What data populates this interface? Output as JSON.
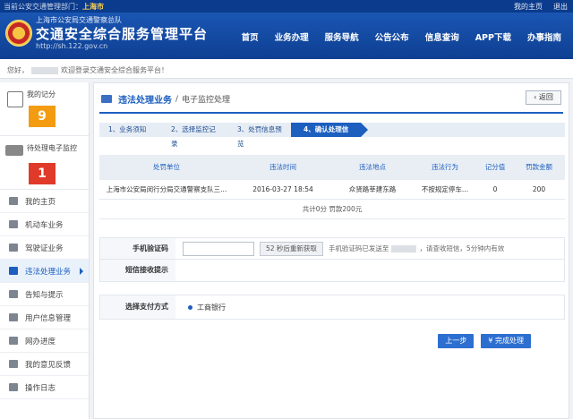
{
  "topbar": {
    "dept_label": "当前公安交通管理部门：",
    "dept_value": "上海市",
    "my_home": "我的主页",
    "logout": "退出"
  },
  "header": {
    "org": "上海市公安局交通警察总队",
    "title": "交通安全综合服务管理平台",
    "url": "http://sh.122.gov.cn",
    "nav": [
      "首页",
      "业务办理",
      "服务导航",
      "公告公布",
      "信息查询",
      "APP下载",
      "办事指南"
    ]
  },
  "welcome": {
    "greeting": "您好，",
    "text": "欢迎登录交通安全综合服务平台！"
  },
  "sidebar": {
    "score_label": "我的记分",
    "score_value": "9",
    "pending_label": "待处理电子监控",
    "pending_value": "1",
    "items": [
      {
        "label": "我的主页",
        "icon": "home-icon"
      },
      {
        "label": "机动车业务",
        "icon": "car-icon"
      },
      {
        "label": "驾驶证业务",
        "icon": "license-icon"
      },
      {
        "label": "违法处理业务",
        "icon": "camera-icon",
        "active": true
      },
      {
        "label": "告知与提示",
        "icon": "bell-icon"
      },
      {
        "label": "用户信息管理",
        "icon": "user-icon"
      },
      {
        "label": "网办进度",
        "icon": "progress-icon"
      },
      {
        "label": "我的意见反馈",
        "icon": "feedback-icon"
      },
      {
        "label": "操作日志",
        "icon": "log-icon"
      }
    ]
  },
  "main": {
    "breadcrumb_main": "违法处理业务",
    "breadcrumb_sep": "/",
    "breadcrumb_sub": "电子监控处理",
    "back": "返回",
    "steps": [
      "1、业务须知",
      "2、选择监控记录",
      "3、处罚信息预览",
      "4、确认处理信息"
    ],
    "table": {
      "headers": [
        "处罚单位",
        "违法时间",
        "违法地点",
        "违法行为",
        "记分值",
        "罚款金额"
      ],
      "rows": [
        [
          "上海市公安局闵行分局交通警察支队三...",
          "2016-03-27 18:54",
          "众贤路莘建东路",
          "不按规定停车...",
          "0",
          "200"
        ]
      ],
      "summary": "共计0分  罚款200元"
    },
    "form": {
      "sms_label": "手机验证码",
      "sms_button": "52 秒后重新获取",
      "sms_hint_pre": "手机验证码已发送至",
      "sms_hint_post": "，请查收短信，5分钟内有效",
      "tip_label": "短信接收提示"
    },
    "payment": {
      "label": "选择支付方式",
      "option": "工商银行"
    },
    "buttons": {
      "prev": "上一步",
      "finish": "完成处理"
    }
  }
}
